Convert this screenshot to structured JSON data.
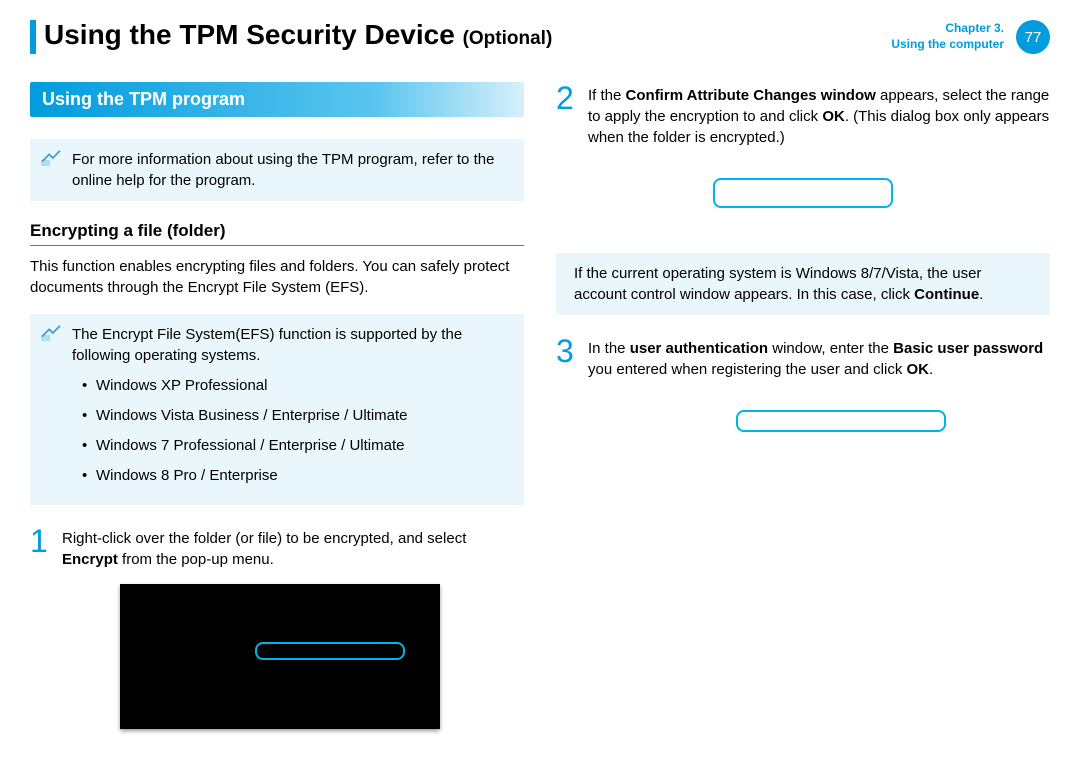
{
  "header": {
    "title": "Using the TPM Security Device",
    "optional": "(Optional)",
    "chapter_line1": "Chapter 3.",
    "chapter_line2": "Using the computer",
    "page_number": "77"
  },
  "left": {
    "section_title": "Using the TPM program",
    "note1": "For more information about using the TPM program, refer to the online help for the program.",
    "subheading": "Encrypting a file (folder)",
    "intro": "This function enables encrypting files and folders. You can safely protect documents through the Encrypt File System (EFS).",
    "note2_lead": "The Encrypt File System(EFS) function is supported by the following operating systems.",
    "os_list": [
      "Windows XP Professional",
      "Windows Vista Business / Enterprise / Ultimate",
      "Windows 7 Professional / Enterprise / Ultimate",
      "Windows 8 Pro / Enterprise"
    ],
    "step1_num": "1",
    "step1_pre": "Right-click over the folder (or file) to be encrypted, and select ",
    "step1_bold": "Encrypt",
    "step1_post": " from the pop-up menu."
  },
  "right": {
    "step2_num": "2",
    "step2_pre": "If the ",
    "step2_b1": "Confirm Attribute Changes window",
    "step2_mid": " appears, select the range to apply the encryption to and click ",
    "step2_b2": "OK",
    "step2_post": ". (This dialog box only appears when the folder is encrypted.)",
    "note3_pre": "If the current operating system is Windows 8/7/Vista, the user account control window appears. In this case, click ",
    "note3_bold": "Continue",
    "note3_post": ".",
    "step3_num": "3",
    "step3_pre": "In the ",
    "step3_b1": "user authentication",
    "step3_mid1": " window, enter the ",
    "step3_b2": "Basic user password",
    "step3_mid2": " you entered when registering the user and click ",
    "step3_b3": "OK",
    "step3_post": "."
  }
}
